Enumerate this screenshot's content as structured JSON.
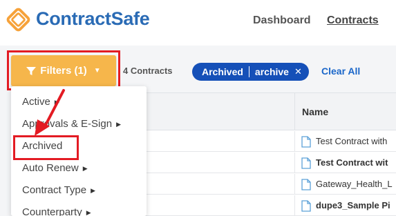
{
  "brand": {
    "name": "ContractSafe",
    "color": "#2a6bb5",
    "accent": "#f6b64b"
  },
  "nav": {
    "dashboard": "Dashboard",
    "contracts": "Contracts"
  },
  "toolbar": {
    "filters_label": "Filters (1)",
    "contract_count": "4 Contracts",
    "chip": {
      "field": "Archived",
      "value": "archive"
    },
    "clear_all": "Clear All"
  },
  "filter_menu": [
    {
      "label": "Active",
      "has_submenu": true
    },
    {
      "label": "Approvals & E-Sign",
      "has_submenu": true
    },
    {
      "label": "Archived",
      "has_submenu": false
    },
    {
      "label": "Auto Renew",
      "has_submenu": true
    },
    {
      "label": "Contract Type",
      "has_submenu": true
    },
    {
      "label": "Counterparty",
      "has_submenu": true
    }
  ],
  "table": {
    "columns": [
      "Name"
    ],
    "rows": [
      {
        "name": "Test Contract with",
        "bold": false
      },
      {
        "name": "Test Contract wit",
        "bold": true
      },
      {
        "name": "Gateway_Health_L",
        "bold": false
      },
      {
        "name": "dupe3_Sample Pi",
        "bold": true
      }
    ]
  },
  "colors": {
    "highlight": "#e31b23",
    "chip": "#1550b8",
    "link": "#1a66c9"
  }
}
